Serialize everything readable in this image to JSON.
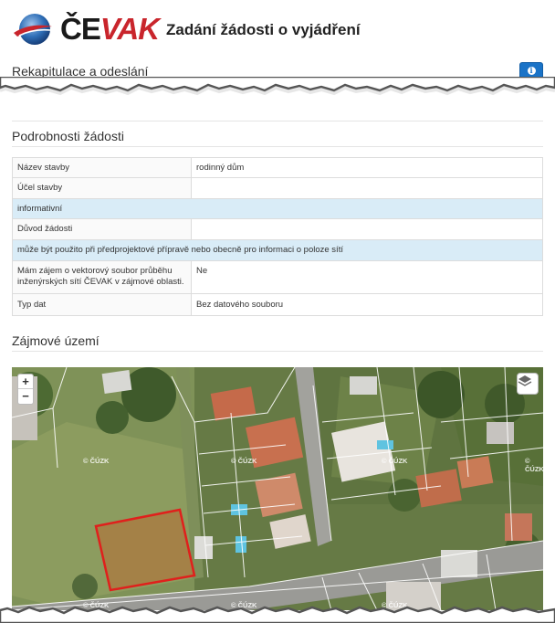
{
  "header": {
    "brand_prefix": "ČE",
    "brand_suffix": "VAK",
    "title": "Zadání žádosti o vyjádření"
  },
  "recap": {
    "heading": "Rekapitulace a odeslání",
    "info_icon": "info-circle-icon"
  },
  "details": {
    "heading": "Podrobnosti žádosti",
    "rows": [
      {
        "key": "Název stavby",
        "value": "rodinný dům"
      },
      {
        "key": "Účel stavby",
        "value": ""
      },
      {
        "full": "informativní"
      },
      {
        "key": "Důvod žádosti",
        "value": ""
      },
      {
        "full": "může být použito při předprojektové přípravě nebo obecně pro informaci o poloze sítí"
      },
      {
        "key": "Mám zájem o vektorový soubor průběhu inženýrských sítí ČEVAK v zájmové oblasti.",
        "value": "Ne"
      },
      {
        "key": "Typ dat",
        "value": "Bez datového souboru"
      }
    ]
  },
  "area": {
    "heading": "Zájmové území",
    "zoom_in": "+",
    "zoom_out": "−",
    "watermark": "© ČÚZK"
  },
  "colors": {
    "brand_red": "#c9252c",
    "info_blue": "#1a73c7",
    "highlight_row": "#d9ecf7",
    "polygon": "#e0201c"
  }
}
